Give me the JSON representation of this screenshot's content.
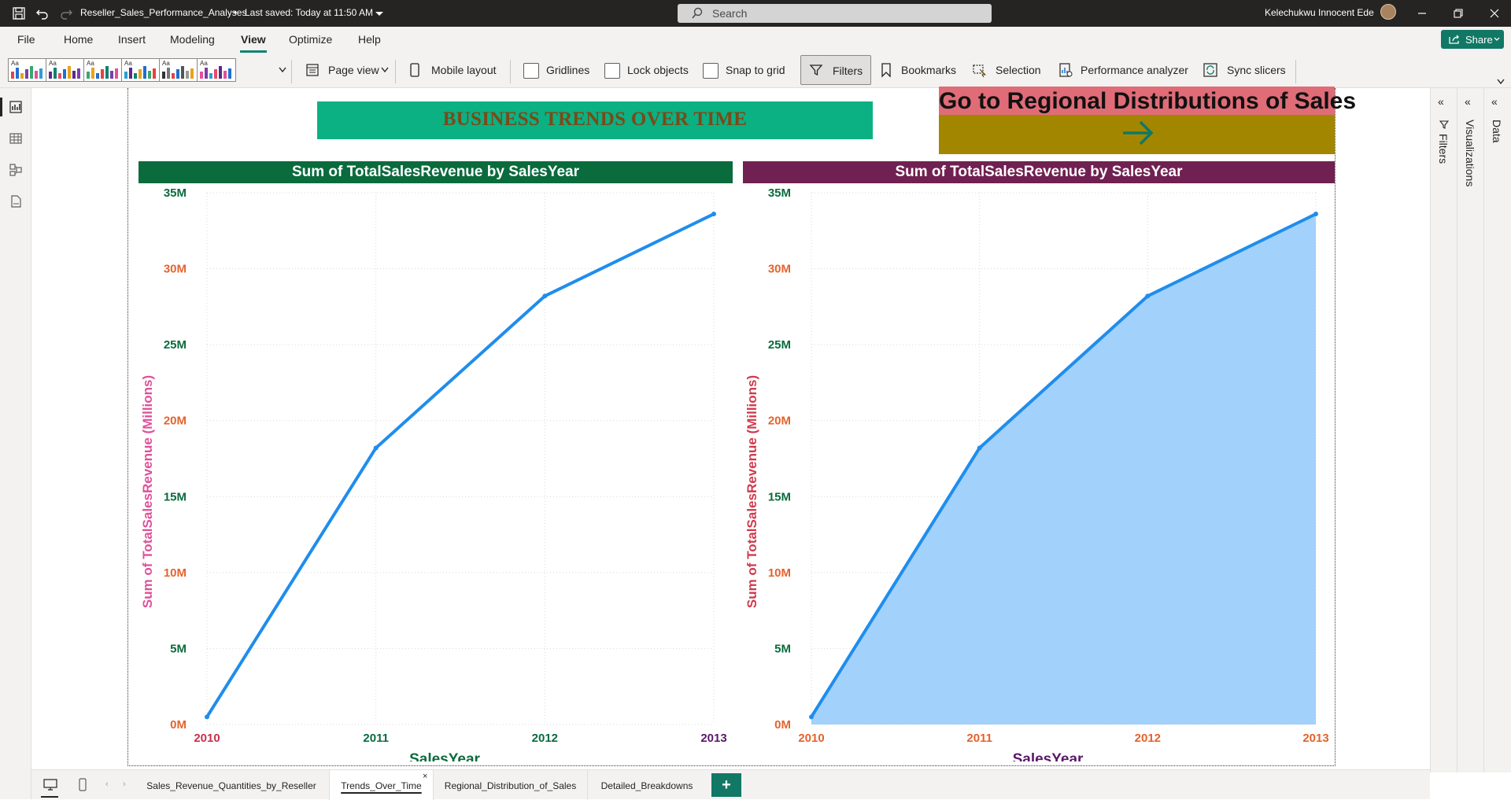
{
  "titlebar": {
    "filename": "Reseller_Sales_Performance_Analyses",
    "saved_status": "Last saved: Today at 11:50 AM",
    "search_placeholder": "Search",
    "user_name": "Kelechukwu Innocent Ede"
  },
  "menu": {
    "items": [
      "File",
      "Home",
      "Insert",
      "Modeling",
      "View",
      "Optimize",
      "Help"
    ],
    "active": "View",
    "share_label": "Share"
  },
  "ribbon": {
    "page_view": "Page view",
    "mobile_layout": "Mobile layout",
    "gridlines": "Gridlines",
    "lock_objects": "Lock objects",
    "snap_to_grid": "Snap to grid",
    "filters": "Filters",
    "bookmarks": "Bookmarks",
    "selection": "Selection",
    "performance_analyzer": "Performance analyzer",
    "sync_slicers": "Sync slicers",
    "theme_aa": "Aa"
  },
  "colors": {
    "banner_bg": "#0bb083",
    "banner_text": "#7a4a18",
    "goto_top": "#e06c78",
    "goto_bottom": "#a38600",
    "chart1_header": "#0a6b3d",
    "chart2_header": "#712052",
    "line": "#1f8ded",
    "area_fill": "#a2d1fb",
    "tick_orange": "#e4632c",
    "tick_darkgreen": "#0a6b3d",
    "tick_crimson": "#c8304b",
    "tick_purple": "#5a1868",
    "ylabel_pink": "#e0509a",
    "ylabel_red": "#d03a4c",
    "brand_teal": "#117865"
  },
  "report": {
    "banner_title": "BUSINESS TRENDS OVER TIME",
    "nav_button_label": "Go to Regional Distributions of Sales"
  },
  "chart_data": [
    {
      "type": "line",
      "title": "Sum of TotalSalesRevenue by SalesYear",
      "xlabel": "SalesYear",
      "ylabel": "Sum of TotalSalesRevenue (Millions)",
      "x": [
        "2010",
        "2011",
        "2012",
        "2013"
      ],
      "values": [
        0.5,
        18.2,
        28.2,
        33.6
      ],
      "unit": "M",
      "ylim": [
        0,
        35
      ],
      "yticks": [
        "0M",
        "5M",
        "10M",
        "15M",
        "20M",
        "25M",
        "30M",
        "35M"
      ],
      "grid": true
    },
    {
      "type": "area",
      "title": "Sum of TotalSalesRevenue by SalesYear",
      "xlabel": "SalesYear",
      "ylabel": "Sum of TotalSalesRevenue (Millions)",
      "x": [
        "2010",
        "2011",
        "2012",
        "2013"
      ],
      "values": [
        0.5,
        18.2,
        28.2,
        33.6
      ],
      "unit": "M",
      "ylim": [
        0,
        35
      ],
      "yticks": [
        "0M",
        "5M",
        "10M",
        "15M",
        "20M",
        "25M",
        "30M",
        "35M"
      ],
      "grid": true
    }
  ],
  "panes": {
    "filters": "Filters",
    "visualizations": "Visualizations",
    "data": "Data"
  },
  "pages": {
    "tabs": [
      "Sales_Revenue_Quantities_by_Reseller",
      "Trends_Over_Time",
      "Regional_Distribution_of_Sales",
      "Detailed_Breakdowns"
    ],
    "active": "Trends_Over_Time",
    "add_label": "+"
  }
}
